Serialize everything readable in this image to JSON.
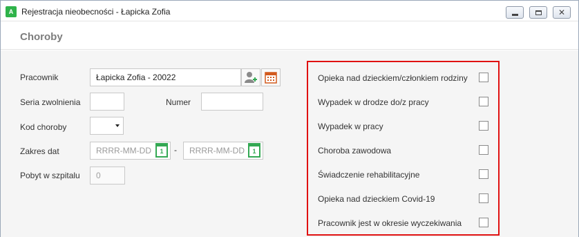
{
  "window": {
    "title": "Rejestracja nieobecności - Łapicka Zofia",
    "app_icon_text": "A"
  },
  "header": {
    "title": "Choroby"
  },
  "form": {
    "employee_label": "Pracownik",
    "employee_value": "Łapicka Zofia - 20022",
    "series_label": "Seria zwolnienia",
    "series_value": "",
    "number_label": "Numer",
    "number_value": "",
    "disease_code_label": "Kod choroby",
    "disease_code_value": "",
    "date_range_label": "Zakres dat",
    "date_from_placeholder": "RRRR-MM-DD",
    "date_separator": "-",
    "date_to_placeholder": "RRRR-MM-DD",
    "calendar_day": "1",
    "hospital_label": "Pobyt w szpitalu",
    "hospital_value": "0"
  },
  "checkboxes": [
    {
      "label": "Opieka nad dzieckiem/członkiem rodziny",
      "checked": false
    },
    {
      "label": "Wypadek w drodze do/z pracy",
      "checked": false
    },
    {
      "label": "Wypadek w pracy",
      "checked": false
    },
    {
      "label": "Choroba zawodowa",
      "checked": false
    },
    {
      "label": "Świadczenie rehabilitacyjne",
      "checked": false
    },
    {
      "label": "Opieka nad dzieckiem Covid-19",
      "checked": false
    },
    {
      "label": "Pracownik jest w okresie wyczekiwania",
      "checked": false
    }
  ],
  "colors": {
    "highlight_border": "#e01010",
    "calendar_green": "#33a853",
    "app_icon_green": "#2fb34a"
  }
}
